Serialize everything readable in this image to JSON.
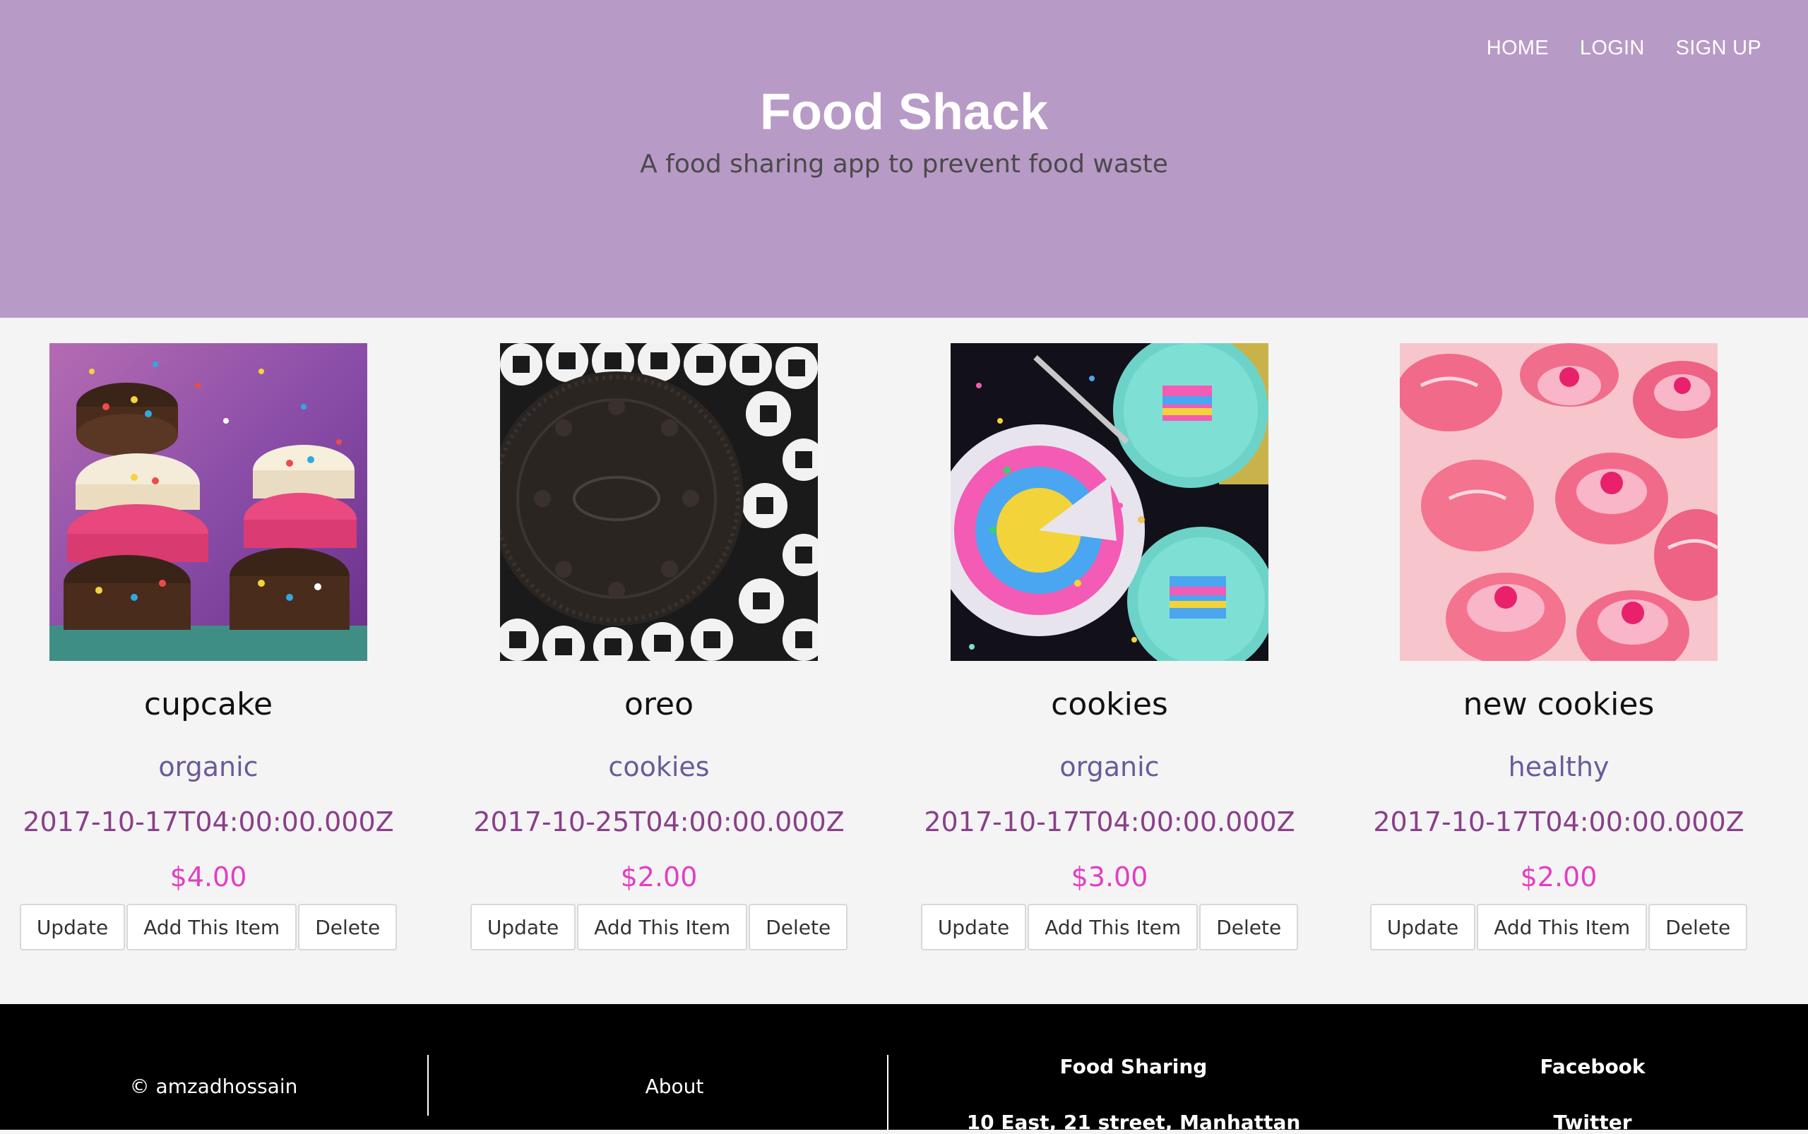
{
  "nav": {
    "items": [
      "HOME",
      "LOGIN",
      "SIGN UP"
    ]
  },
  "header": {
    "title": "Food Shack",
    "subtitle": "A food sharing app to prevent food waste"
  },
  "cards": [
    {
      "name": "cupcake",
      "category": "organic",
      "date": "2017-10-17T04:00:00.000Z",
      "price": "$4.00",
      "image": "macarons-image"
    },
    {
      "name": "oreo",
      "category": "cookies",
      "date": "2017-10-25T04:00:00.000Z",
      "price": "$2.00",
      "image": "oreo-image"
    },
    {
      "name": "cookies",
      "category": "organic",
      "date": "2017-10-17T04:00:00.000Z",
      "price": "$3.00",
      "image": "rainbow-cake-image"
    },
    {
      "name": "new cookies",
      "category": "healthy",
      "date": "2017-10-17T04:00:00.000Z",
      "price": "$2.00",
      "image": "pink-cupcakes-image"
    }
  ],
  "buttons": {
    "update": "Update",
    "add": "Add This Item",
    "delete": "Delete"
  },
  "footer": {
    "copyright": "© amzadhossain",
    "about": "About",
    "col3_title": "Food Sharing",
    "col3_line": "10 East, 21 street, Manhattan",
    "col4_title": "Facebook",
    "col4_line": "Twitter"
  },
  "colors": {
    "header_bg": "#b89ac6",
    "category": "#6a5a9a",
    "date": "#8a3f8a",
    "price": "#e23ec4",
    "footer_bg": "#000000"
  }
}
